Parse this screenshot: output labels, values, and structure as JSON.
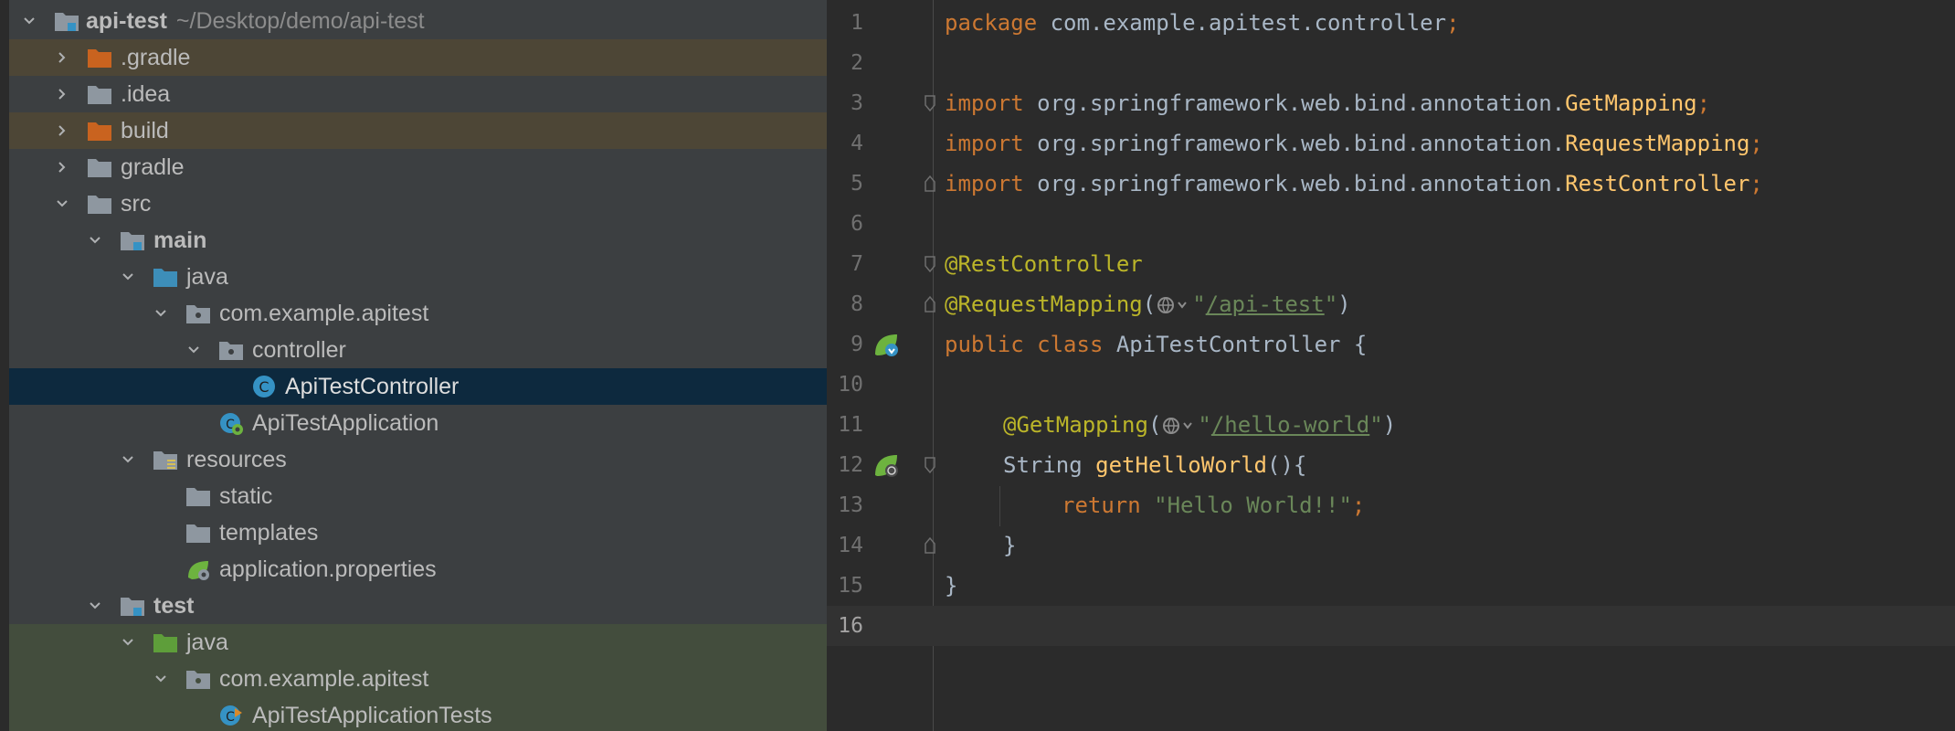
{
  "project": {
    "root": {
      "name": "api-test",
      "path": "~/Desktop/demo/api-test"
    },
    "items": [
      {
        "label": ".gradle",
        "icon": "folder-orange-icon",
        "chevron": "right"
      },
      {
        "label": ".idea",
        "icon": "folder-icon",
        "chevron": "right"
      },
      {
        "label": "build",
        "icon": "folder-orange-icon",
        "chevron": "right"
      },
      {
        "label": "gradle",
        "icon": "folder-icon",
        "chevron": "right"
      },
      {
        "label": "src",
        "icon": "folder-icon",
        "chevron": "down"
      },
      {
        "label": "main",
        "icon": "module-folder-icon",
        "chevron": "down"
      },
      {
        "label": "java",
        "icon": "source-folder-icon",
        "chevron": "down"
      },
      {
        "label": "com.example.apitest",
        "icon": "package-icon",
        "chevron": "down"
      },
      {
        "label": "controller",
        "icon": "package-icon",
        "chevron": "down"
      },
      {
        "label": "ApiTestController",
        "icon": "java-class-icon"
      },
      {
        "label": "ApiTestApplication",
        "icon": "spring-boot-class-icon"
      },
      {
        "label": "resources",
        "icon": "resources-folder-icon",
        "chevron": "down"
      },
      {
        "label": "static",
        "icon": "folder-icon"
      },
      {
        "label": "templates",
        "icon": "folder-icon"
      },
      {
        "label": "application.properties",
        "icon": "spring-properties-icon"
      },
      {
        "label": "test",
        "icon": "module-folder-icon",
        "chevron": "down"
      },
      {
        "label": "java",
        "icon": "test-folder-icon",
        "chevron": "down"
      },
      {
        "label": "com.example.apitest",
        "icon": "package-icon",
        "chevron": "down"
      },
      {
        "label": "ApiTestApplicationTests",
        "icon": "spring-boot-test-class-icon"
      }
    ]
  },
  "editor": {
    "lines": [
      {
        "n": "1",
        "pkg_kw": "package",
        "pkg_name": " com.example.apitest.controller",
        "semi": ";"
      },
      {
        "n": "2"
      },
      {
        "n": "3",
        "kw": "import",
        "path": " org.springframework.web.bind.annotation.",
        "cls": "GetMapping",
        "semi": ";"
      },
      {
        "n": "4",
        "kw": "import",
        "path": " org.springframework.web.bind.annotation.",
        "cls": "RequestMapping",
        "semi": ";"
      },
      {
        "n": "5",
        "kw": "import",
        "path": " org.springframework.web.bind.annotation.",
        "cls": "RestController",
        "semi": ";"
      },
      {
        "n": "6"
      },
      {
        "n": "7",
        "ann": "@RestController"
      },
      {
        "n": "8",
        "ann": "@RequestMapping",
        "open": "(",
        "q1": "\"",
        "url": "/api-test",
        "q2": "\"",
        "close": ")"
      },
      {
        "n": "9",
        "kw": "public class",
        "name": " ApiTestController {"
      },
      {
        "n": "10"
      },
      {
        "n": "11",
        "ann": "@GetMapping",
        "open": "(",
        "q1": "\"",
        "url": "/hello-world",
        "q2": "\"",
        "close": ")"
      },
      {
        "n": "12",
        "type": "String ",
        "meth": "getHelloWorld",
        "rest": "(){"
      },
      {
        "n": "13",
        "kw": "return ",
        "str": "\"Hello World!!\"",
        "semi": ";"
      },
      {
        "n": "14",
        "text": "}"
      },
      {
        "n": "15",
        "text": "}"
      },
      {
        "n": "16"
      }
    ]
  },
  "colors": {
    "keyword": "#cc7832",
    "annotation": "#bbb529",
    "class_name": "#ffc66d",
    "string": "#6a8759",
    "text": "#a9b7c6"
  }
}
